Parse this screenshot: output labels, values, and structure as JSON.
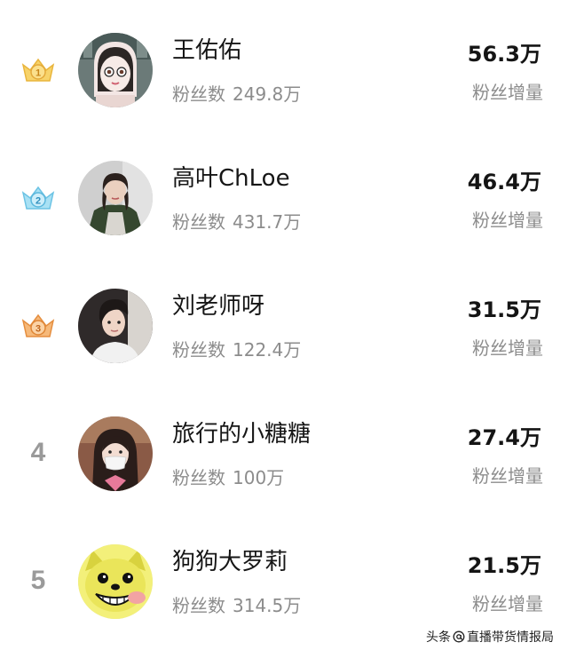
{
  "list": {
    "items": [
      {
        "rank": "1",
        "rank_style": "medal",
        "medal_color": "#f5c04a",
        "name": "王佑佑",
        "fans_label": "粉丝数",
        "fans_value": "249.8万",
        "gain_value": "56.3万",
        "gain_label": "粉丝增量",
        "avatar": "cartoon-girl-avatar"
      },
      {
        "rank": "2",
        "rank_style": "medal",
        "medal_color": "#7fd0ee",
        "name": "高叶ChLoe",
        "fans_label": "粉丝数",
        "fans_value": "431.7万",
        "gain_value": "46.4万",
        "gain_label": "粉丝增量",
        "avatar": "woman-green-coat-avatar"
      },
      {
        "rank": "3",
        "rank_style": "medal",
        "medal_color": "#f0a55c",
        "name": "刘老师呀",
        "fans_label": "粉丝数",
        "fans_value": "122.4万",
        "gain_value": "31.5万",
        "gain_label": "粉丝增量",
        "avatar": "young-man-avatar"
      },
      {
        "rank": "4",
        "rank_style": "number",
        "name": "旅行的小糖糖",
        "fans_label": "粉丝数",
        "fans_value": "100万",
        "gain_value": "27.4万",
        "gain_label": "粉丝增量",
        "avatar": "woman-mask-avatar"
      },
      {
        "rank": "5",
        "rank_style": "number",
        "name": "狗狗大罗莉",
        "fans_label": "粉丝数",
        "fans_value": "314.5万",
        "gain_value": "21.5万",
        "gain_label": "粉丝增量",
        "avatar": "cartoon-dog-avatar"
      }
    ]
  },
  "watermark": {
    "prefix": "头条",
    "handle": "直播带货情报局"
  }
}
